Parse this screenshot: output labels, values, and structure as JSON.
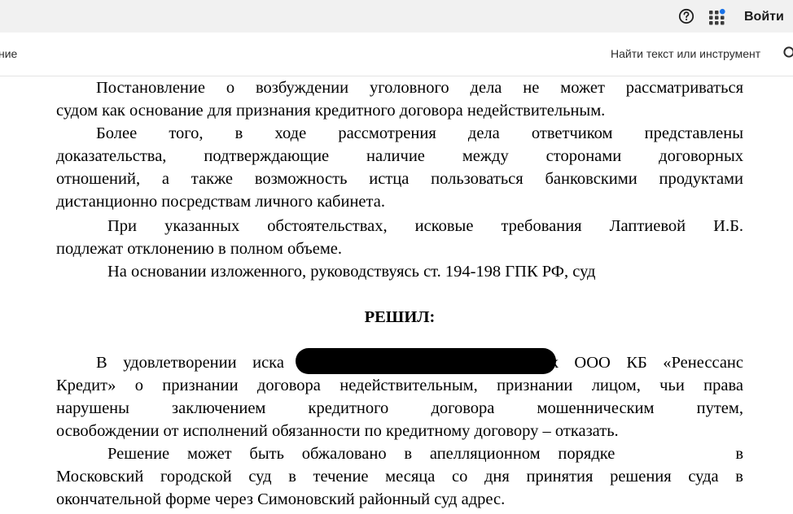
{
  "topbar": {
    "login_label": "Войти",
    "help_icon": "help-circle-icon",
    "apps_icon": "apps-grid-icon",
    "notification_dot_color": "#1a73e8"
  },
  "toolbar": {
    "left_label": "ние",
    "search_placeholder": "Найти текст или инструмент",
    "search_icon": "search-icon"
  },
  "document": {
    "p1": [
      "Постановление о возбуждении уголовного дела не может рассматриваться",
      "судом как основание для признания кредитного договора недействительным."
    ],
    "p2": [
      "Более того, в ходе рассмотрения дела ответчиком представлены",
      "доказательства, подтверждающие наличие между сторонами договорных",
      "отношений, а также возможность истца пользоваться банковскими продуктами",
      "дистанционно посредствам личного кабинета."
    ],
    "p3": [
      "При указанных обстоятельствах, исковые требования Лаптиевой И.Б.",
      "подлежат отклонению в полном объеме."
    ],
    "p4": "На основании изложенного, руководствуясь ст. 194-198 ГПК РФ, суд",
    "heading": "РЕШИЛ:",
    "p5_start": "В удовлетворении иска",
    "p5_end": "к ООО КБ «Ренессанс",
    "p5": [
      "Кредит» о признании договора недействительным, признании лицом, чьи права",
      "нарушены заключением кредитного договора мошенническим путем,",
      "освобождении от исполнений обязанности по кредитному договору – отказать."
    ],
    "p6_start": "Решение может быть обжаловано в апелляционном порядке",
    "p6_end": "в",
    "p6": [
      "Московский городской суд в течение месяца со дня принятия решения суда в",
      "окончательной форме через Симоновский районный суд адрес."
    ]
  }
}
